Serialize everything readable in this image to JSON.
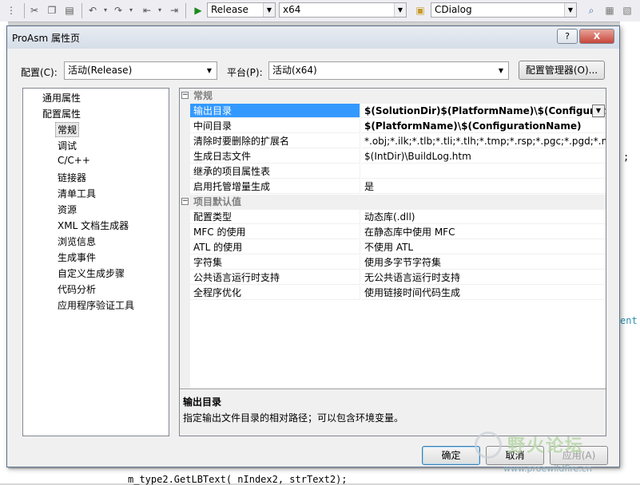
{
  "ide": {
    "config_combo": "Release",
    "platform_combo": "x64",
    "class_combo": "CDialog",
    "code_fragments": {
      "right_semicolon": ";",
      "right_ent": "ent",
      "bottom_line": "m_type2.GetLBText( nIndex2, strText2);"
    }
  },
  "dialog": {
    "title": "ProAsm 属性页",
    "help_label": "?",
    "close_label": "X",
    "config_label": "配置(C):",
    "config_value": "活动(Release)",
    "platform_label": "平台(P):",
    "platform_value": "活动(x64)",
    "config_manager_button": "配置管理器(O)...",
    "tree": {
      "items": [
        "通用属性",
        "配置属性",
        "常规",
        "调试",
        "C/C++",
        "链接器",
        "清单工具",
        "资源",
        "XML 文档生成器",
        "浏览信息",
        "生成事件",
        "自定义生成步骤",
        "代码分析",
        "应用程序验证工具"
      ],
      "selected": "常规"
    },
    "grid": {
      "categories": [
        "常规",
        "项目默认值"
      ],
      "general": [
        {
          "name": "输出目录",
          "value": "$(SolutionDir)$(PlatformName)\\$(Configurati"
        },
        {
          "name": "中间目录",
          "value": "$(PlatformName)\\$(ConfigurationName)"
        },
        {
          "name": "清除时要删除的扩展名",
          "value": "*.obj;*.ilk;*.tlb;*.tli;*.tlh;*.tmp;*.rsp;*.pgc;*.pgd;*.meta;$"
        },
        {
          "name": "生成日志文件",
          "value": "$(IntDir)\\BuildLog.htm"
        },
        {
          "name": "继承的项目属性表",
          "value": ""
        },
        {
          "name": "启用托管增量生成",
          "value": "是"
        }
      ],
      "defaults": [
        {
          "name": "配置类型",
          "value": "动态库(.dll)"
        },
        {
          "name": "MFC 的使用",
          "value": "在静态库中使用 MFC"
        },
        {
          "name": "ATL 的使用",
          "value": "不使用 ATL"
        },
        {
          "name": "字符集",
          "value": "使用多字节字符集"
        },
        {
          "name": "公共语言运行时支持",
          "value": "无公共语言运行时支持"
        },
        {
          "name": "全程序优化",
          "value": "使用链接时间代码生成"
        }
      ]
    },
    "description": {
      "title": "输出目录",
      "text": "指定输出文件目录的相对路径；可以包含环境变量。"
    },
    "buttons": {
      "ok": "确定",
      "cancel": "取消",
      "apply": "应用(A)"
    }
  },
  "watermark": {
    "text": "野火论坛",
    "url": "www.proewildfire.cn"
  }
}
